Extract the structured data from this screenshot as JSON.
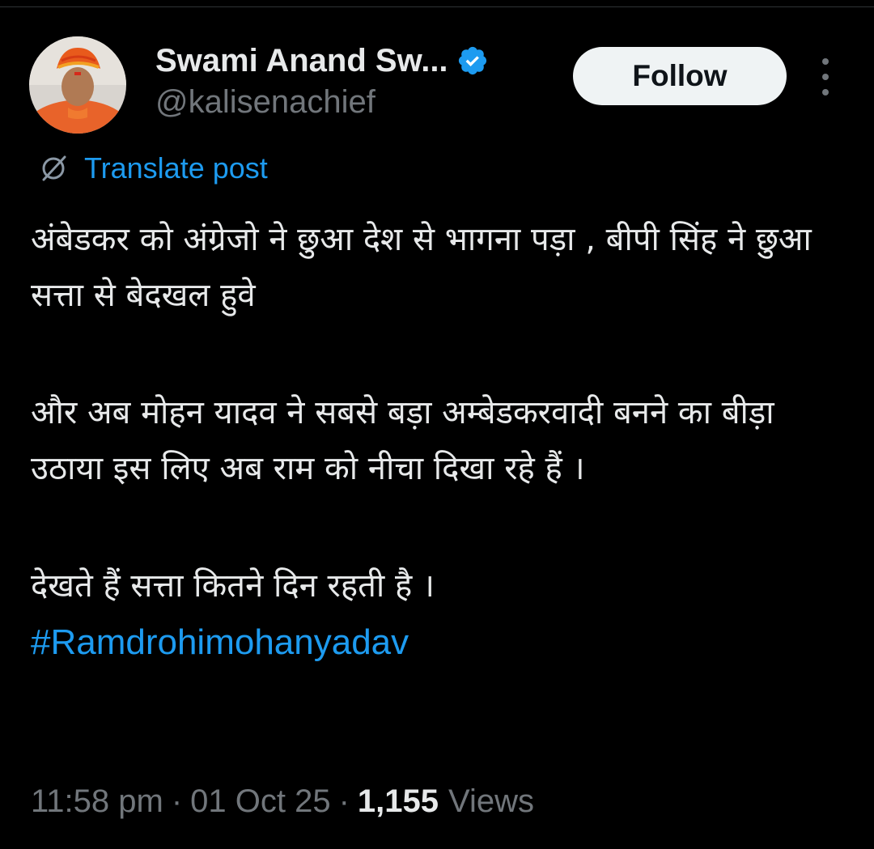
{
  "author": {
    "display_name": "Swami Anand Sw...",
    "handle": "@kalisenachief",
    "avatar_icon": "profile-avatar",
    "verified_icon": "verified-badge-icon"
  },
  "actions": {
    "follow_label": "Follow",
    "more_icon": "more-options-icon"
  },
  "translate": {
    "label": "Translate post",
    "icon": "translate-icon"
  },
  "post": {
    "paragraphs": [
      "अंबेडकर को अंग्रेजो ने छुआ देश से भागना पड़ा , बीपी सिंह ने छुआ सत्ता से बेदखल हुवे",
      "और अब मोहन यादव ने सबसे बड़ा अम्बेडकरवादी बनने का बीड़ा उठाया इस लिए अब राम को नीचा दिखा रहे हैं ।",
      "देखते हैं सत्ता कितने दिन रहती है ।"
    ],
    "hashtag": "#Ramdrohimohanyadav"
  },
  "meta": {
    "time": "11:58 pm",
    "date": "01 Oct 25",
    "separator": "·",
    "views_count": "1,155",
    "views_label": "Views"
  },
  "colors": {
    "background": "#000000",
    "text_primary": "#e7e9ea",
    "text_secondary": "#71767b",
    "accent": "#1d9bf0",
    "follow_bg": "#eff3f4"
  }
}
